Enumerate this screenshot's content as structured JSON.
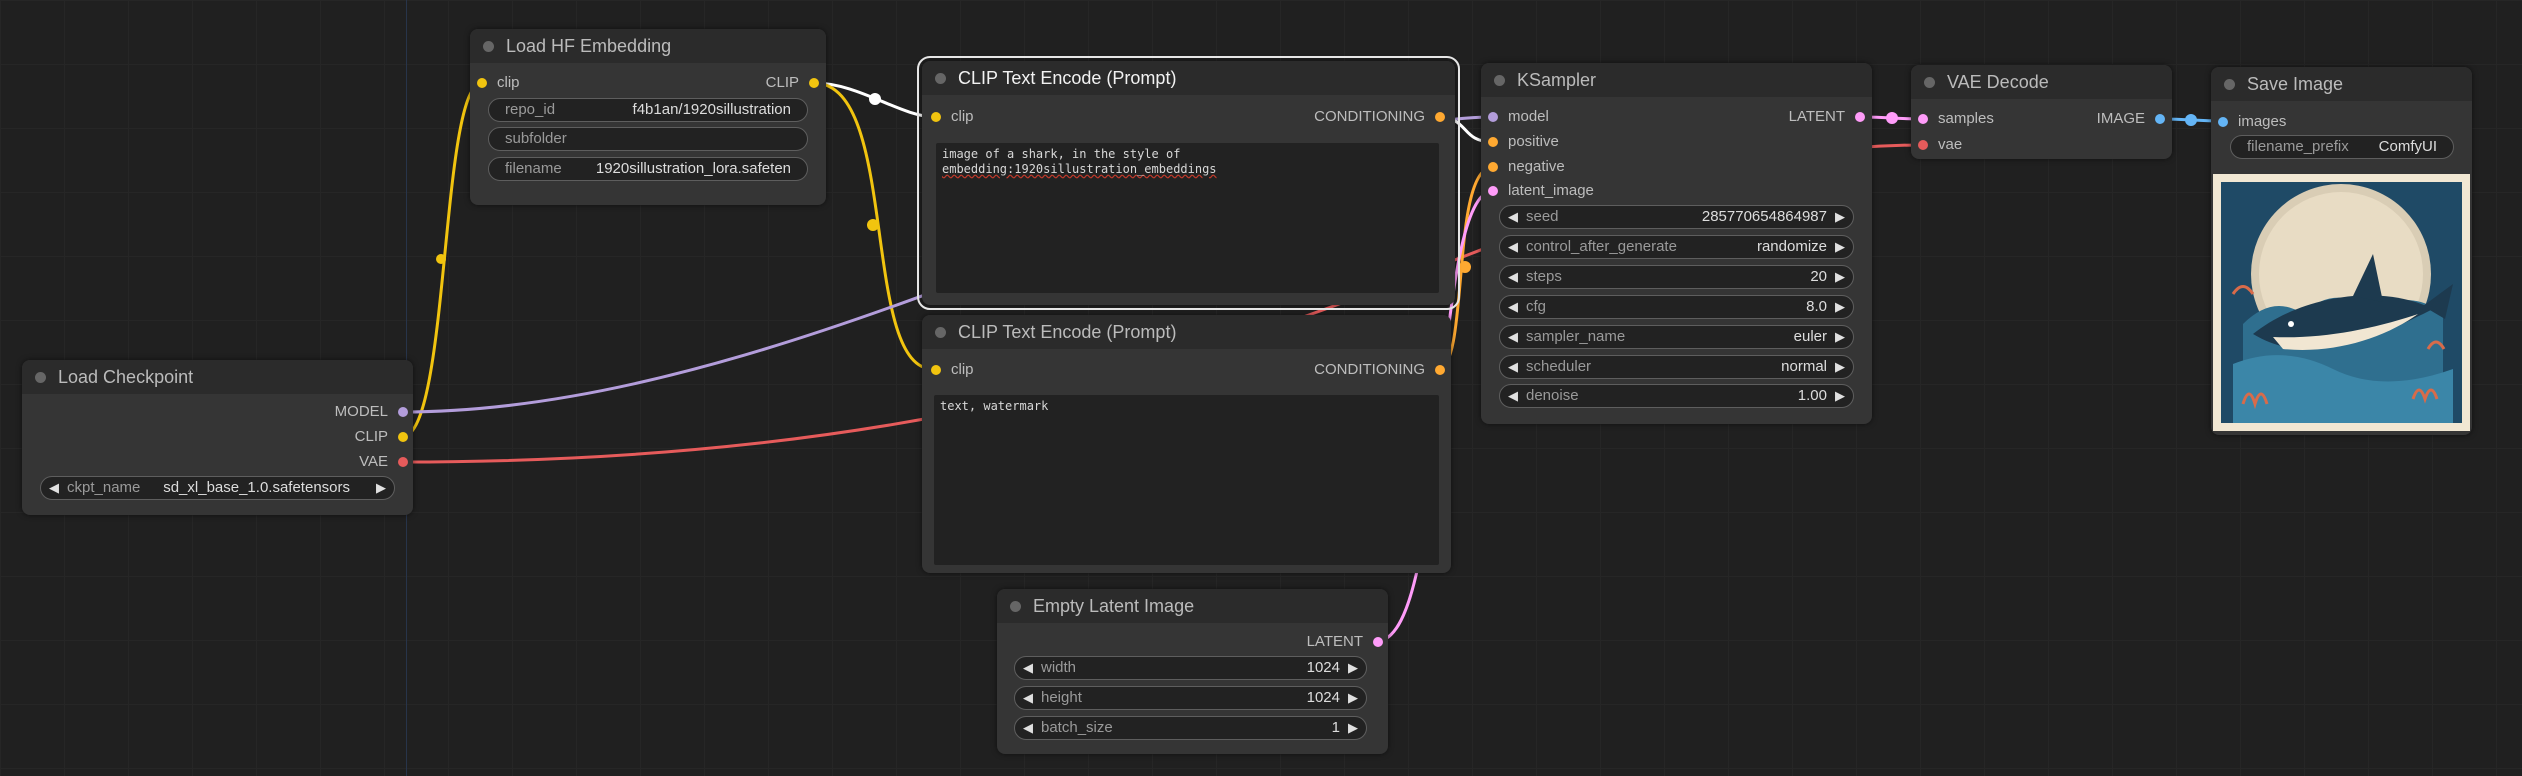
{
  "colors": {
    "clip": "#f1c40f",
    "model": "#b39ddb",
    "vae": "#e65b5b",
    "conditioning": "#ffa931",
    "latent": "#ff9cf9",
    "image": "#64b5f6"
  },
  "nodes": {
    "load_hf_embedding": {
      "title": "Load HF Embedding",
      "inputs": [
        "clip"
      ],
      "outputs": [
        "CLIP"
      ],
      "widgets": [
        {
          "label": "repo_id",
          "value": "f4b1an/1920sillustration"
        },
        {
          "label": "subfolder",
          "value": ""
        },
        {
          "label": "filename",
          "value": "1920sillustration_lora.safeten"
        }
      ]
    },
    "load_checkpoint": {
      "title": "Load Checkpoint",
      "outputs": [
        "MODEL",
        "CLIP",
        "VAE"
      ],
      "widgets": [
        {
          "label": "ckpt_name",
          "value": "sd_xl_base_1.0.safetensors"
        }
      ]
    },
    "clip_positive": {
      "title": "CLIP Text Encode (Prompt)",
      "inputs": [
        "clip"
      ],
      "outputs": [
        "CONDITIONING"
      ],
      "text_line1": "image of a shark, in the style of",
      "text_line2": "embedding:1920sillustration_embeddings"
    },
    "clip_negative": {
      "title": "CLIP Text Encode (Prompt)",
      "inputs": [
        "clip"
      ],
      "outputs": [
        "CONDITIONING"
      ],
      "text": "text, watermark"
    },
    "empty_latent": {
      "title": "Empty Latent Image",
      "outputs": [
        "LATENT"
      ],
      "widgets": [
        {
          "label": "width",
          "value": "1024"
        },
        {
          "label": "height",
          "value": "1024"
        },
        {
          "label": "batch_size",
          "value": "1"
        }
      ]
    },
    "ksampler": {
      "title": "KSampler",
      "inputs": [
        "model",
        "positive",
        "negative",
        "latent_image"
      ],
      "outputs": [
        "LATENT"
      ],
      "widgets": [
        {
          "label": "seed",
          "value": "285770654864987"
        },
        {
          "label": "control_after_generate",
          "value": "randomize"
        },
        {
          "label": "steps",
          "value": "20"
        },
        {
          "label": "cfg",
          "value": "8.0"
        },
        {
          "label": "sampler_name",
          "value": "euler"
        },
        {
          "label": "scheduler",
          "value": "normal"
        },
        {
          "label": "denoise",
          "value": "1.00"
        }
      ]
    },
    "vae_decode": {
      "title": "VAE Decode",
      "inputs": [
        "samples",
        "vae"
      ],
      "outputs": [
        "IMAGE"
      ]
    },
    "save_image": {
      "title": "Save Image",
      "inputs": [
        "images"
      ],
      "widgets": [
        {
          "label": "filename_prefix",
          "value": "ComfyUI"
        }
      ]
    }
  },
  "icons": {
    "left_arrow": "◀",
    "right_arrow": "▶"
  }
}
